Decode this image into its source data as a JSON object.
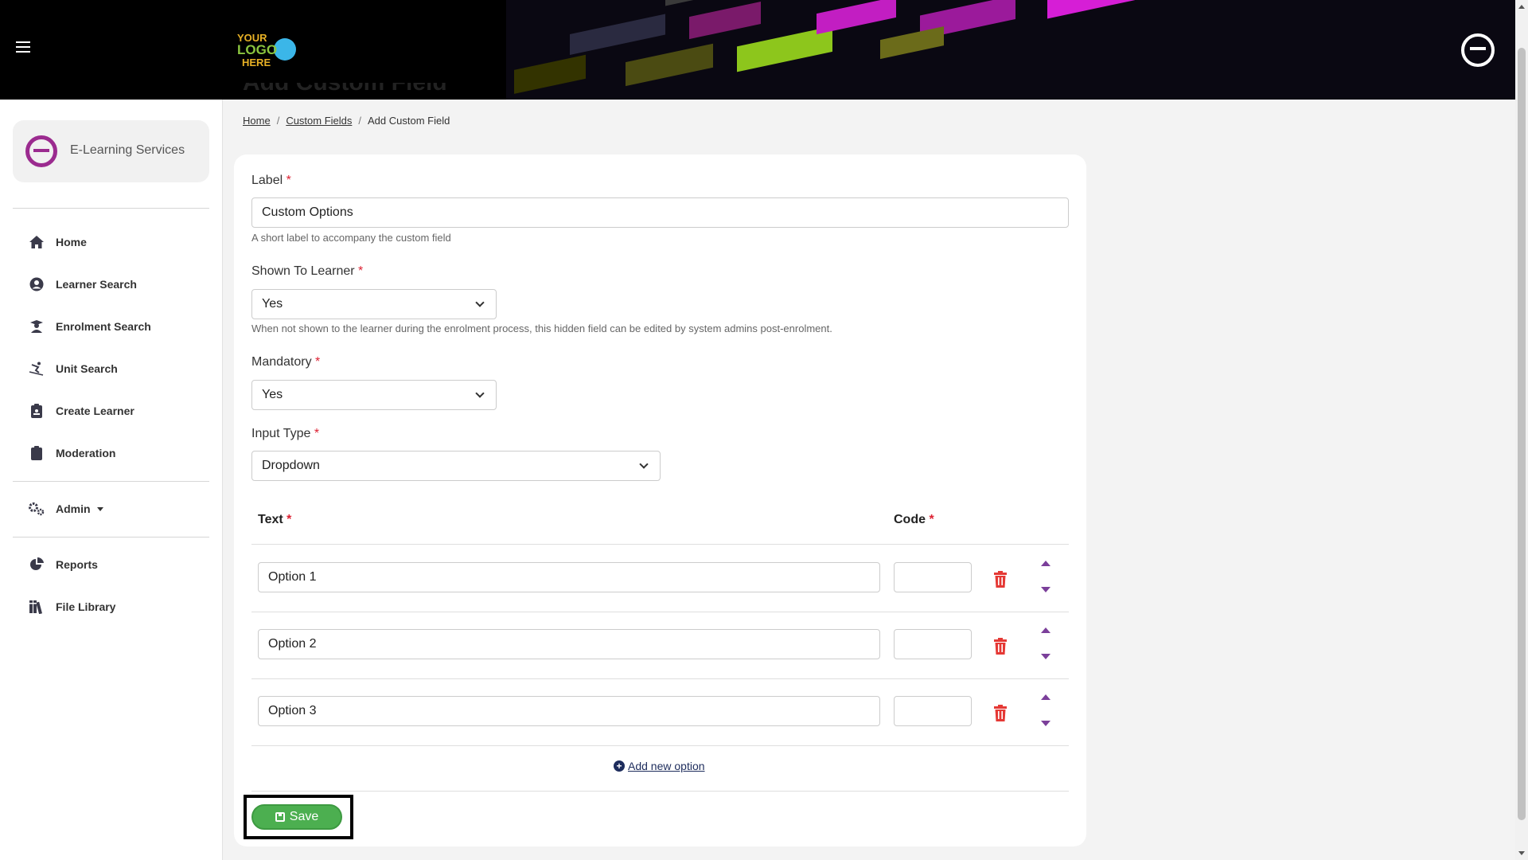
{
  "header": {
    "logo_text": "YOUR LOGO HERE",
    "menu_icon": "hamburger-icon",
    "brand_icon": "e-logo-icon"
  },
  "sidebar": {
    "org_name": "E-Learning Services",
    "items": [
      {
        "label": "Home",
        "icon": "home-icon"
      },
      {
        "label": "Learner Search",
        "icon": "user-circle-icon"
      },
      {
        "label": "Enrolment Search",
        "icon": "graduate-icon"
      },
      {
        "label": "Unit Search",
        "icon": "skier-icon"
      },
      {
        "label": "Create Learner",
        "icon": "clipboard-id-icon"
      },
      {
        "label": "Moderation",
        "icon": "clipboard-icon"
      },
      {
        "label": "Admin",
        "icon": "gears-icon"
      },
      {
        "label": "Reports",
        "icon": "pie-chart-icon"
      },
      {
        "label": "File Library",
        "icon": "books-icon"
      }
    ]
  },
  "page": {
    "title": "Add Custom Field",
    "breadcrumb": [
      "Home",
      "Custom Fields",
      "Add Custom Field"
    ]
  },
  "form": {
    "label": {
      "title": "Label",
      "required": "*",
      "value": "Custom Options",
      "help": "A short label to accompany the custom field"
    },
    "shown": {
      "title": "Shown To Learner",
      "required": "*",
      "value": "Yes",
      "help": "When not shown to the learner during the enrolment process, this hidden field can be edited by system admins post-enrolment."
    },
    "mandatory": {
      "title": "Mandatory",
      "required": "*",
      "value": "Yes"
    },
    "input_type": {
      "title": "Input Type",
      "required": "*",
      "value": "Dropdown"
    },
    "options_table": {
      "headers": {
        "text": "Text",
        "code": "Code",
        "required": "*"
      },
      "rows": [
        {
          "text": "Option 1",
          "code": ""
        },
        {
          "text": "Option 2",
          "code": ""
        },
        {
          "text": "Option 3",
          "code": ""
        }
      ]
    },
    "add_option": "Add new option",
    "save": "Save"
  },
  "colors": {
    "accent": "#9b2b8f",
    "save": "#4caf50",
    "danger": "#e53935",
    "arrows": "#7b3f9a"
  }
}
